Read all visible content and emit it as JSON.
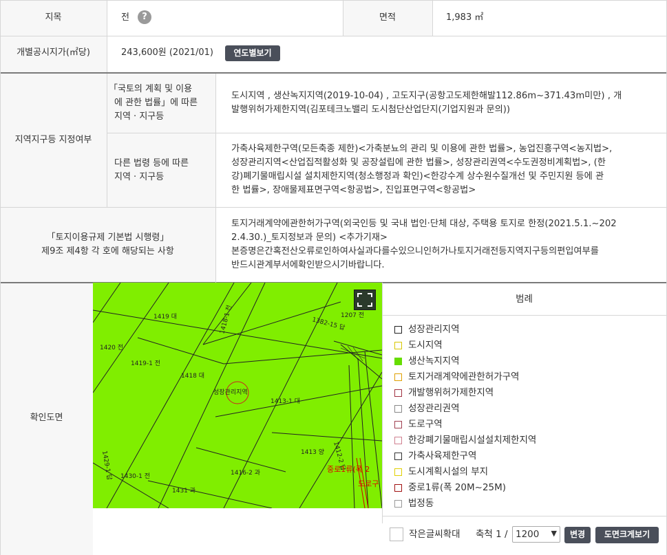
{
  "row1": {
    "jimok_label": "지목",
    "jimok_value": "전",
    "help_icon_text": "?",
    "area_label": "면적",
    "area_value": "1,983 ㎡"
  },
  "row2": {
    "label": "개별공시지가(㎡당)",
    "value": "243,600원 (2021/01)",
    "button": "연도별보기"
  },
  "zone": {
    "label": "지역지구등 지정여부",
    "sub1_label": "「국토의 계획 및 이용에 관한 법률」에 따른 지역 · 지구등",
    "sub1_lines": [
      "「국토의 계획 및 이용",
      "에 관한 법률」에 따른",
      "지역 · 지구등"
    ],
    "sub1_value_lines": [
      "도시지역 , 생산녹지지역(2019-10-04) , 고도지구(공항고도제한해발112.86m~371.43m미만) , 개",
      "발행위허가제한지역(김포테크노밸리 도시첨단산업단지(기업지원과 문의))"
    ],
    "sub2_lines": [
      "다른 법령 등에 따른",
      "지역 · 지구등"
    ],
    "sub2_value_lines": [
      "가축사육제한구역(모든축종 제한)<가축분뇨의 관리 및 이용에 관한 법률>, 농업진흥구역<농지법>,",
      "성장관리지역<산업집적활성화 및 공장설립에 관한 법률>, 성장관리권역<수도권정비계획법>, (한",
      "강)폐기물매립시설 설치제한지역(청소행정과 확인)<한강수계 상수원수질개선 및 주민지원 등에 관",
      "한 법률>, 장애물제표면구역<항공법>, 진입표면구역<항공법>"
    ]
  },
  "regulation": {
    "label_lines": [
      "「토지이용규제 기본법 시행령」",
      "제9조 제4항 각 호에 해당되는 사항"
    ],
    "value_lines": [
      "토지거래계약에관한허가구역(외국인등 및 국내 법인·단체 대상, 주택용 토지로 한정(2021.5.1.~202",
      "2.4.30.)_토지정보과 문의) <추가기재>",
      "본증명은간혹전산오류로인하여사실과다를수있으니인허가나토지거래전등지역지구등의편입여부를",
      "반드시관계부서에확인받으시기바랍니다."
    ]
  },
  "map_section": {
    "label": "확인도면",
    "map_labels": {
      "p1419": "1419 대",
      "p1420": "1420 전",
      "p1419_1": "1419-1 전",
      "p1418": "1418 대",
      "p1418_1": "1418-1 전",
      "p1207": "1207 전",
      "p1413_1": "1413-1 대",
      "p1413": "1413 양",
      "p1416_2": "1416-2 과",
      "p1430_1": "1430-1 전",
      "p1429_1": "1429-1 답",
      "p1431": "1431 과",
      "p1412_2": "1412-2 답",
      "zone_label": "성장관리지역",
      "road_label": "중로1류(폭 2",
      "road_label2": "도로구",
      "road_small": "1382-15 답"
    },
    "legend_title": "범례",
    "legend": [
      {
        "label": "성장관리지역",
        "border": "#222222",
        "fill": "#ffffff"
      },
      {
        "label": "도시지역",
        "border": "#d8c800",
        "fill": "#ffffff"
      },
      {
        "label": "생산녹지지역",
        "border": "#66dd00",
        "fill": "#66dd00"
      },
      {
        "label": "토지거래계약에관한허가구역",
        "border": "#e0a000",
        "fill": "#ffffff"
      },
      {
        "label": "개발행위허가제한지역",
        "border": "#a03040",
        "fill": "#ffffff"
      },
      {
        "label": "성장관리권역",
        "border": "#888888",
        "fill": "#ffffff"
      },
      {
        "label": "도로구역",
        "border": "#a04050",
        "fill": "#ffffff"
      },
      {
        "label": "한강폐기물매립시설설치제한지역",
        "border": "#d08090",
        "fill": "#ffffff"
      },
      {
        "label": "가축사육제한구역",
        "border": "#333333",
        "fill": "#ffffff"
      },
      {
        "label": "도시계획시설의 부지",
        "border": "#e0d000",
        "fill": "#ffffff"
      },
      {
        "label": "중로1류(폭 20M~25M)",
        "border": "#a01010",
        "fill": "#ffffff"
      },
      {
        "label": "법정동",
        "border": "#999999",
        "fill": "#ffffff"
      }
    ],
    "small_text_label": "작은글씨확대",
    "scale_label": "축척 1 /",
    "scale_value": "1200",
    "change_button": "변경",
    "enlarge_button": "도면크게보기"
  },
  "colors": {
    "map_green": "#80ee00",
    "header_bg": "#f7f7f7",
    "button_dark": "#4a4f5a"
  }
}
